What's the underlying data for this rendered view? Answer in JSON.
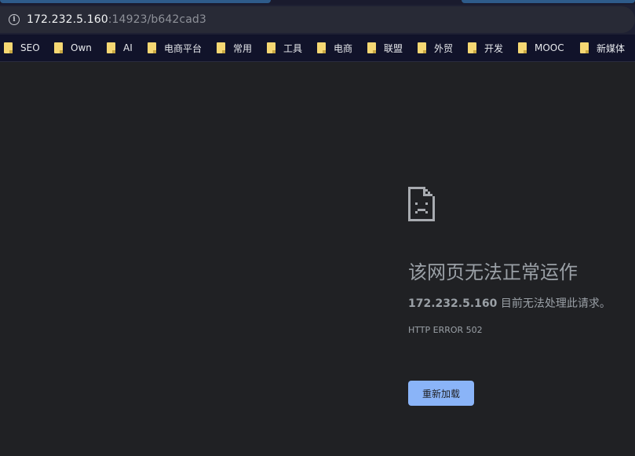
{
  "address_bar": {
    "host": "172.232.5.160",
    "path": ":14923/b642cad3",
    "icon": "info-icon"
  },
  "bookmarks": [
    {
      "label": "SEO",
      "icon": "folder-icon"
    },
    {
      "label": "Own",
      "icon": "folder-icon"
    },
    {
      "label": "AI",
      "icon": "folder-icon"
    },
    {
      "label": "电商平台",
      "icon": "folder-icon"
    },
    {
      "label": "常用",
      "icon": "folder-icon"
    },
    {
      "label": "工具",
      "icon": "folder-icon"
    },
    {
      "label": "电商",
      "icon": "folder-icon"
    },
    {
      "label": "联盟",
      "icon": "folder-icon"
    },
    {
      "label": "外贸",
      "icon": "folder-icon"
    },
    {
      "label": "开发",
      "icon": "folder-icon"
    },
    {
      "label": "MOOC",
      "icon": "folder-icon"
    },
    {
      "label": "新媒体",
      "icon": "folder-icon"
    }
  ],
  "error": {
    "icon": "sad-page-icon",
    "title": "该网页无法正常运作",
    "message_host": "172.232.5.160",
    "message_text": " 目前无法处理此请求。",
    "code": "HTTP ERROR 502",
    "reload_label": "重新加载"
  },
  "colors": {
    "background": "#202124",
    "button": "#8ab4f8",
    "text": "#9aa0a6",
    "folder": "#f6d873"
  }
}
